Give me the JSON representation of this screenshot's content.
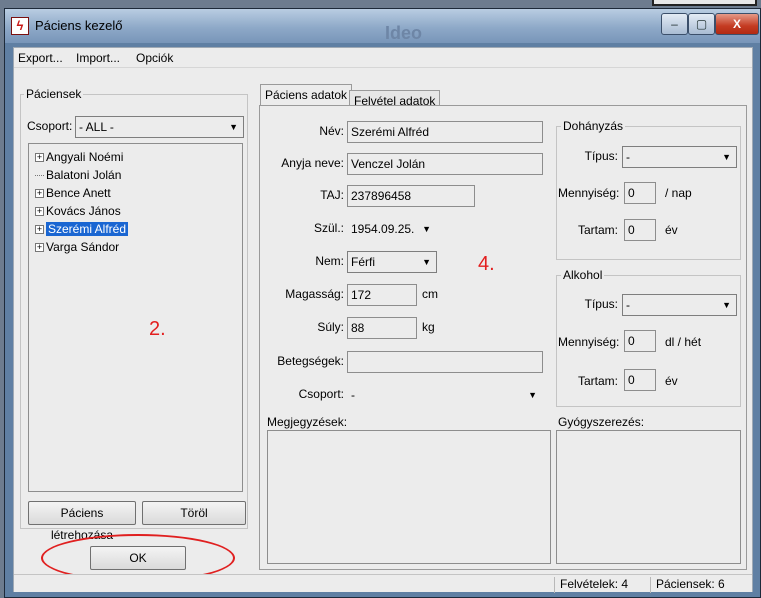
{
  "window": {
    "title": "Páciens kezelő",
    "background_text": "Ideo",
    "close_label": "X"
  },
  "menu": [
    "Export...",
    "Import...",
    "Opciók"
  ],
  "patients_panel": {
    "group_label": "Páciensek",
    "group_filter_label": "Csoport:",
    "group_filter_value": "- ALL -",
    "tree": [
      {
        "label": "Angyali Noémi",
        "expand": "+"
      },
      {
        "label": "Balatoni Jolán",
        "expand": ""
      },
      {
        "label": "Bence Anett",
        "expand": "+"
      },
      {
        "label": "Kovács János",
        "expand": "+"
      },
      {
        "label": "Szerémi Alfréd",
        "expand": "+",
        "selected": true
      },
      {
        "label": "Varga Sándor",
        "expand": "+"
      }
    ],
    "create_button": "Páciens létrehozása",
    "delete_button": "Töröl",
    "ok_button": "OK",
    "annotation": "2."
  },
  "tabs": [
    "Páciens adatok",
    "Felvétel adatok"
  ],
  "form": {
    "name_label": "Név:",
    "name_value": "Szerémi Alfréd",
    "mother_label": "Anyja neve:",
    "mother_value": "Venczel Jolán",
    "taj_label": "TAJ:",
    "taj_value": "237896458",
    "birth_label": "Szül.:",
    "birth_value": "1954.09.25.",
    "sex_label": "Nem:",
    "sex_value": "Férfi",
    "height_label": "Magasság:",
    "height_value": "172",
    "height_unit": "cm",
    "weight_label": "Súly:",
    "weight_value": "88",
    "weight_unit": "kg",
    "diseases_label": "Betegségek:",
    "diseases_value": "",
    "group_label": "Csoport:",
    "group_value": "-",
    "notes_label": "Megjegyzések:",
    "annotation": "4."
  },
  "smoking": {
    "title": "Dohányzás",
    "type_label": "Típus:",
    "type_value": "-",
    "amount_label": "Mennyiség:",
    "amount_value": "0",
    "amount_unit": "/ nap",
    "duration_label": "Tartam:",
    "duration_value": "0",
    "duration_unit": "év"
  },
  "alcohol": {
    "title": "Alkohol",
    "type_label": "Típus:",
    "type_value": "-",
    "amount_label": "Mennyiség:",
    "amount_value": "0",
    "amount_unit": "dl / hét",
    "duration_label": "Tartam:",
    "duration_value": "0",
    "duration_unit": "év"
  },
  "medication_label": "Gyógyszerezés:",
  "status": {
    "admissions": "Felvételek: 4",
    "patients": "Páciensek: 6"
  },
  "colors": {
    "selection": "#1a66d2",
    "annotation": "#e31f1f",
    "close_button": "#c43b22"
  }
}
